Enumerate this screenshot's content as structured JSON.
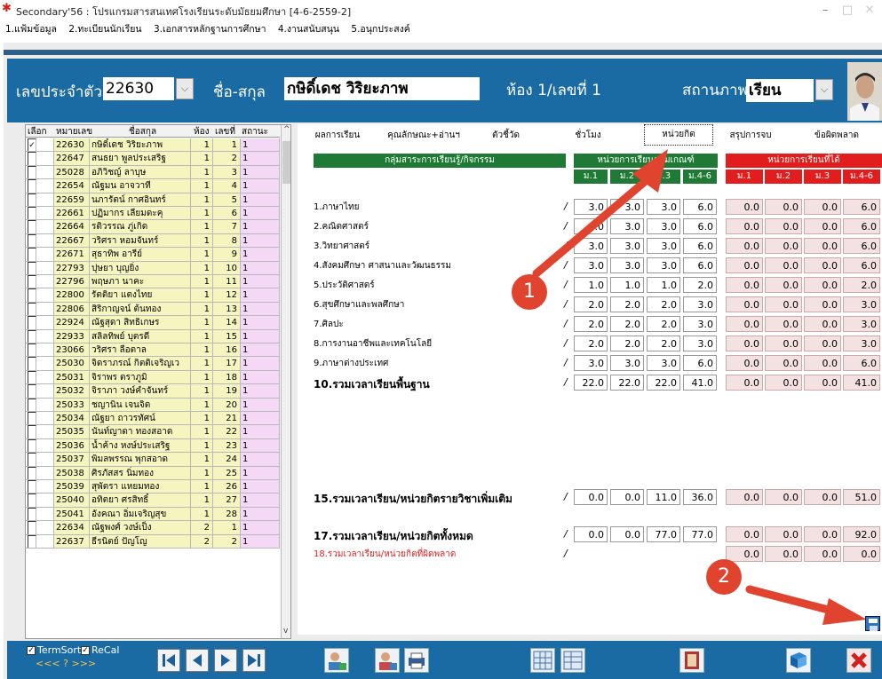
{
  "window": {
    "title": "Secondary'56 : โปรแกรมสารสนเทศโรงเรียนระดับมัธยมศึกษา [4-6-2559-2]",
    "minimize": "–",
    "maximize": "□",
    "close": "✕"
  },
  "menu": [
    "1.แฟ้มข้อมูล",
    "2.ทะเบียนนักเรียน",
    "3.เอกสารหลักฐานการศึกษา",
    "4.งานสนับสนุน",
    "5.อนุกประสงค์"
  ],
  "header": {
    "id_label": "เลขประจำตัว",
    "id_value": "22630",
    "name_label": "ชื่อ-สกุล",
    "name_value": "กษิดิ์เดช วิริยะภาพ",
    "room_text": "ห้อง 1/เลขที่ 1",
    "status_label": "สถานภาพ",
    "status_value": "เรียน"
  },
  "student_table": {
    "headers": [
      "เลือก",
      "หมายเลข",
      "ชื่อสกุล",
      "ห้อง",
      "เลขที่",
      "สถานะ"
    ],
    "rows": [
      {
        "checked": true,
        "id": "22630",
        "name": "กษิดิ์เดช วิริยะภาพ",
        "room": "1",
        "no": "1",
        "status": "1"
      },
      {
        "checked": false,
        "id": "22647",
        "name": "สนธยา พูลประเสริฐ",
        "room": "1",
        "no": "2",
        "status": "1"
      },
      {
        "checked": false,
        "id": "25028",
        "name": "อภิวิชญ์ ลาบุษ",
        "room": "1",
        "no": "3",
        "status": "1"
      },
      {
        "checked": false,
        "id": "22654",
        "name": "ณัฐมน อาจวาที",
        "room": "1",
        "no": "4",
        "status": "1"
      },
      {
        "checked": false,
        "id": "22659",
        "name": "นภารัตน์ กาศอินทร์",
        "room": "1",
        "no": "5",
        "status": "1"
      },
      {
        "checked": false,
        "id": "22661",
        "name": "ปฏิมากร เลียมดะคุ",
        "room": "1",
        "no": "6",
        "status": "1"
      },
      {
        "checked": false,
        "id": "22664",
        "name": "รติวรรณ ภู่เกิด",
        "room": "1",
        "no": "7",
        "status": "1"
      },
      {
        "checked": false,
        "id": "22667",
        "name": "วริศรา หอมจันทร์",
        "room": "1",
        "no": "8",
        "status": "1"
      },
      {
        "checked": false,
        "id": "22671",
        "name": "สุธาทิพ อารีย์",
        "room": "1",
        "no": "9",
        "status": "1"
      },
      {
        "checked": false,
        "id": "22793",
        "name": "ปุษยา บุญยิ่ง",
        "room": "1",
        "no": "10",
        "status": "1"
      },
      {
        "checked": false,
        "id": "22796",
        "name": "พฤษภา นาคะ",
        "room": "1",
        "no": "11",
        "status": "1"
      },
      {
        "checked": false,
        "id": "22800",
        "name": "รัตติยา แตงไทย",
        "room": "1",
        "no": "12",
        "status": "1"
      },
      {
        "checked": false,
        "id": "22806",
        "name": "สิริกาญจน์ ต้นทอง",
        "room": "1",
        "no": "13",
        "status": "1"
      },
      {
        "checked": false,
        "id": "22924",
        "name": "ณัฐสุดา สิทธิเกษร",
        "room": "1",
        "no": "14",
        "status": "1"
      },
      {
        "checked": false,
        "id": "22933",
        "name": "สลิลทิพย์ บุตรดี",
        "room": "1",
        "no": "15",
        "status": "1"
      },
      {
        "checked": false,
        "id": "23066",
        "name": "วริศรา ลือตาล",
        "room": "1",
        "no": "16",
        "status": "1"
      },
      {
        "checked": false,
        "id": "25030",
        "name": "จิดราภรณ์ กิตติเจริญเว",
        "room": "1",
        "no": "17",
        "status": "1"
      },
      {
        "checked": false,
        "id": "25031",
        "name": "จิราพร ตราภูมิ",
        "room": "1",
        "no": "18",
        "status": "1"
      },
      {
        "checked": false,
        "id": "25032",
        "name": "จิราภา วงษ์คำจันทร์",
        "room": "1",
        "no": "19",
        "status": "1"
      },
      {
        "checked": false,
        "id": "25033",
        "name": "ชญานิน เจนจิต",
        "room": "1",
        "no": "20",
        "status": "1"
      },
      {
        "checked": false,
        "id": "25034",
        "name": "ณัฐยา ถาวรทัศน์",
        "room": "1",
        "no": "21",
        "status": "1"
      },
      {
        "checked": false,
        "id": "25035",
        "name": "นันท์ญาดา ทองสอาด",
        "room": "1",
        "no": "22",
        "status": "1"
      },
      {
        "checked": false,
        "id": "25036",
        "name": "น้ำค้าง หงษ์ประเสริฐ",
        "room": "1",
        "no": "23",
        "status": "1"
      },
      {
        "checked": false,
        "id": "25037",
        "name": "พิมลพรรณ พุกสอาด",
        "room": "1",
        "no": "24",
        "status": "1"
      },
      {
        "checked": false,
        "id": "25038",
        "name": "ศิรภัสสร นิ่มทอง",
        "room": "1",
        "no": "25",
        "status": "1"
      },
      {
        "checked": false,
        "id": "25039",
        "name": "สุพัตรา แหยมทอง",
        "room": "1",
        "no": "26",
        "status": "1"
      },
      {
        "checked": false,
        "id": "25040",
        "name": "อทิตยา ศรสิทธิ์",
        "room": "1",
        "no": "27",
        "status": "1"
      },
      {
        "checked": false,
        "id": "25041",
        "name": "อังคณา อิ่มเจริญสุข",
        "room": "1",
        "no": "28",
        "status": "1"
      },
      {
        "checked": false,
        "id": "22634",
        "name": "ณัฐพงศ์ วงษ์เป็ง",
        "room": "2",
        "no": "1",
        "status": "1"
      },
      {
        "checked": false,
        "id": "22637",
        "name": "ธีรนิตย์ ปัญโญ",
        "room": "2",
        "no": "2",
        "status": "1"
      }
    ]
  },
  "tabs": [
    "ผลการเรียน",
    "คุณลักษณะ+อ่านฯ",
    "ตัวชี้วัด",
    "ชั่วโมง",
    "หน่วยกิต",
    "สรุปการจบ",
    "ข้อผิดพลาด"
  ],
  "active_tab": "หน่วยกิต",
  "group_headers": {
    "subjects": "กลุ่มสาระการเรียนรู้/กิจกรรม",
    "required": "หน่วยการเรียนตามเกณฑ์",
    "earned": "หน่วยการเรียนที่ได้"
  },
  "grade_headers": [
    "ม.1",
    "ม.2",
    "ม.3",
    "ม.4-6"
  ],
  "subjects": [
    {
      "name": "1.ภาษาไทย",
      "req": [
        "3.0",
        "3.0",
        "3.0",
        "6.0"
      ],
      "got": [
        "0.0",
        "0.0",
        "0.0",
        "6.0"
      ]
    },
    {
      "name": "2.คณิตศาสตร์",
      "req": [
        "3.0",
        "3.0",
        "3.0",
        "6.0"
      ],
      "got": [
        "0.0",
        "0.0",
        "0.0",
        "6.0"
      ]
    },
    {
      "name": "3.วิทยาศาสตร์",
      "req": [
        "3.0",
        "3.0",
        "3.0",
        "6.0"
      ],
      "got": [
        "0.0",
        "0.0",
        "0.0",
        "6.0"
      ]
    },
    {
      "name": "4.สังคมศึกษา ศาสนาและวัฒนธรรม",
      "req": [
        "3.0",
        "3.0",
        "3.0",
        "6.0"
      ],
      "got": [
        "0.0",
        "0.0",
        "0.0",
        "6.0"
      ]
    },
    {
      "name": "5.ประวัติศาสตร์",
      "req": [
        "1.0",
        "1.0",
        "1.0",
        "2.0"
      ],
      "got": [
        "0.0",
        "0.0",
        "0.0",
        "2.0"
      ]
    },
    {
      "name": "6.สุขศึกษาและพลศึกษา",
      "req": [
        "2.0",
        "2.0",
        "2.0",
        "3.0"
      ],
      "got": [
        "0.0",
        "0.0",
        "0.0",
        "3.0"
      ]
    },
    {
      "name": "7.ศิลปะ",
      "req": [
        "2.0",
        "2.0",
        "2.0",
        "3.0"
      ],
      "got": [
        "0.0",
        "0.0",
        "0.0",
        "3.0"
      ]
    },
    {
      "name": "8.การงานอาชีพและเทคโนโลยี",
      "req": [
        "2.0",
        "2.0",
        "2.0",
        "3.0"
      ],
      "got": [
        "0.0",
        "0.0",
        "0.0",
        "3.0"
      ]
    },
    {
      "name": "9.ภาษาต่างประเทศ",
      "req": [
        "3.0",
        "3.0",
        "3.0",
        "6.0"
      ],
      "got": [
        "0.0",
        "0.0",
        "0.0",
        "6.0"
      ]
    },
    {
      "name": "10.รวมเวลาเรียนพื้นฐาน",
      "req": [
        "22.0",
        "22.0",
        "22.0",
        "41.0"
      ],
      "got": [
        "0.0",
        "0.0",
        "0.0",
        "41.0"
      ],
      "bold": true
    }
  ],
  "totals": [
    {
      "name": "15.รวมเวลาเรียน/หน่วยกิตรายวิชาเพิ่มเติม",
      "req": [
        "0.0",
        "0.0",
        "11.0",
        "36.0"
      ],
      "got": [
        "0.0",
        "0.0",
        "0.0",
        "51.0"
      ],
      "bold": true
    },
    {
      "name": "17.รวมเวลาเรียน/หน่วยกิตทั้งหมด",
      "req": [
        "0.0",
        "0.0",
        "77.0",
        "77.0"
      ],
      "got": [
        "0.0",
        "0.0",
        "0.0",
        "92.0"
      ],
      "bold": true
    },
    {
      "name": "18.รวมเวลาเรียน/หน่วยกิตที่ผิดพลาด",
      "req": null,
      "got": [
        "0.0",
        "0.0",
        "0.0",
        "0.0"
      ],
      "red": true
    }
  ],
  "slash": "/",
  "callouts": [
    "1",
    "2"
  ],
  "bottom": {
    "termsort_label": "TermSort",
    "recal_label": "ReCal",
    "nav_hint": "<<< ? >>>"
  },
  "colors": {
    "header_bg": "#1a6ba3",
    "green_header": "#1e7a34",
    "red_header": "#e21d1d",
    "pink_cell": "#f4e1e1",
    "row_yellow": "#f5f5c0",
    "row_pink": "#f5d8f5",
    "callout": "#e0442f"
  }
}
